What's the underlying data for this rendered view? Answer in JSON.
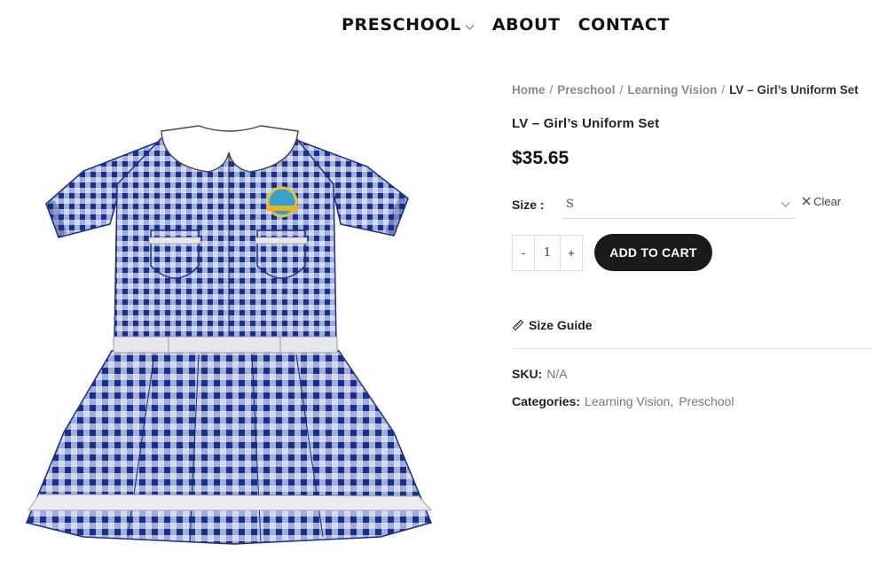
{
  "nav": {
    "items": [
      {
        "label": "PRESCHOOL",
        "has_dropdown": true
      },
      {
        "label": "ABOUT"
      },
      {
        "label": "CONTACT"
      }
    ]
  },
  "breadcrumb": {
    "items": [
      "Home",
      "Preschool",
      "Learning Vision"
    ],
    "current": "LV – Girl’s Uniform Set"
  },
  "product": {
    "title": "LV – Girl’s Uniform Set",
    "price": "$35.65",
    "size_label": "Size :",
    "size_value": "S",
    "clear_label": "Clear",
    "qty_minus": "-",
    "qty_value": "1",
    "qty_plus": "+",
    "add_to_cart": "ADD TO CART",
    "size_guide": "Size Guide",
    "sku_label": "SKU:",
    "sku_value": "N/A",
    "categories_label": "Categories:",
    "categories": [
      "Learning Vision",
      "Preschool"
    ],
    "image_icon": "dress-illustration"
  },
  "colors": {
    "dress_blue": "#1f3c9b",
    "button_dark": "#1b1b1b",
    "muted_text": "#8a8a8a"
  }
}
